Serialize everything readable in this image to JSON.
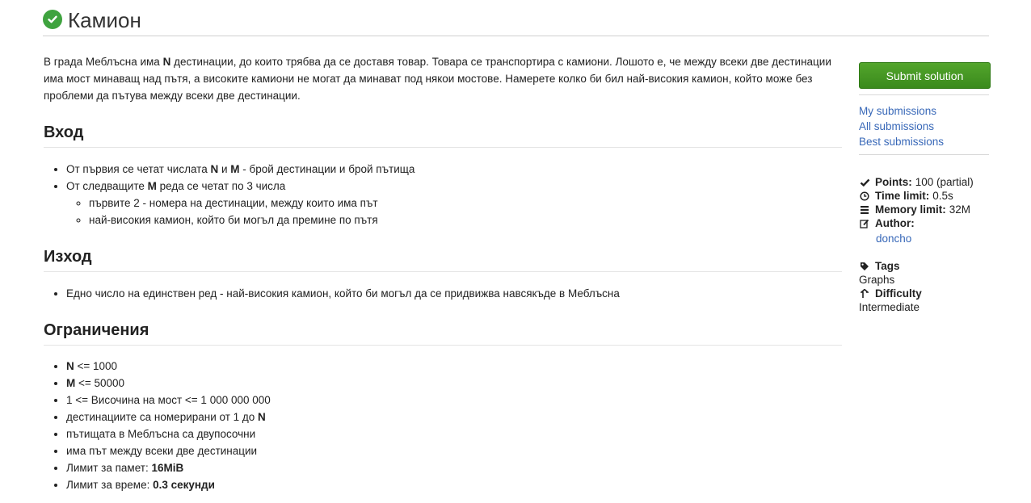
{
  "header": {
    "title": "Камион"
  },
  "intro": {
    "p1": "В града Меблъсна има ",
    "n": "N",
    "p2": " дестинации, до които трябва да се доставя товар. Товара се транспортира с камиони. Лошото е, че между всеки две дестинации има мост минаващ над пътя, а високите камиони не могат да минават под някои мостове. Намерете колко би бил най-високия камион, който може без проблеми да пътува между всеки две дестинации."
  },
  "input": {
    "heading": "Вход",
    "item1": {
      "a": "От първия се четат числата ",
      "n": "N",
      "b": " и ",
      "m": "M",
      "c": " - брой дестинации и брой пътища"
    },
    "item2": {
      "a": "От следващите ",
      "m": "M",
      "b": " реда се четат по 3 числа"
    },
    "sub": [
      "първите 2 - номера на дестинации, между които има път",
      "най-високия камион, който би могъл да премине по пътя"
    ]
  },
  "output": {
    "heading": "Изход",
    "item1": "Едно число на единствен ред - най-високия камион, който би могъл да се придвижва навсякъде в Меблъсна"
  },
  "constraints": {
    "heading": "Ограничения",
    "c1": {
      "b": "N",
      "t": " <= 1000"
    },
    "c2": {
      "b": "M",
      "t": " <= 50000"
    },
    "c3": "1 <= Височина на мост <= 1 000 000 000",
    "c4": {
      "t": "дестинациите са номерирани от 1 до ",
      "b": "N"
    },
    "c5": "пътищата в Меблъсна са двупосочни",
    "c6": "има път между всеки две дестинации",
    "c7": {
      "t": "Лимит за памет: ",
      "b": "16MiB"
    },
    "c8": {
      "t": "Лимит за време: ",
      "b": "0.3 секунди"
    }
  },
  "sidebar": {
    "submit_label": "Submit solution",
    "links": [
      "My submissions",
      "All submissions",
      "Best submissions"
    ],
    "points_label": "Points:",
    "points_value": "100 (partial)",
    "time_label": "Time limit:",
    "time_value": "0.5s",
    "memory_label": "Memory limit:",
    "memory_value": "32M",
    "author_label": "Author:",
    "author_value": "doncho",
    "tags_label": "Tags",
    "tags_value": "Graphs",
    "difficulty_label": "Difficulty",
    "difficulty_value": "Intermediate"
  },
  "colors": {
    "accent_green": "#3fa33f",
    "link": "#3868b8",
    "button": "#44982a"
  },
  "icons": [
    "check-circle-icon",
    "check-icon",
    "clock-icon",
    "memory-icon",
    "pencil-icon",
    "tag-icon",
    "arrow-up-icon"
  ]
}
